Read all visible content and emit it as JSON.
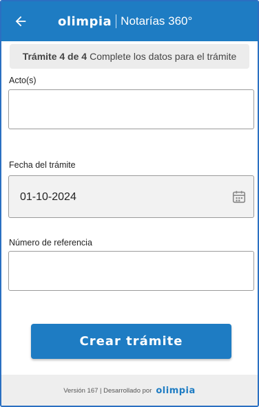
{
  "header": {
    "brand_logo": "OLIMPIA",
    "brand_subtitle": "Notarías 360°",
    "back_icon": "arrow-left-icon"
  },
  "step_banner": {
    "step_label": "Trámite 4 de 4",
    "instruction": "Complete los datos para el trámite"
  },
  "form": {
    "acto": {
      "label": "Acto(s)",
      "value": ""
    },
    "fecha": {
      "label": "Fecha del trámite",
      "value": "01-10-2024",
      "icon": "calendar-icon"
    },
    "referencia": {
      "label": "Número de referencia",
      "value": ""
    }
  },
  "actions": {
    "create_label": "Crear trámite"
  },
  "footer": {
    "version_text": "Versión 167 | Desarrollado por",
    "logo": "OLIMPIA"
  },
  "colors": {
    "primary": "#1e7cc3",
    "banner_bg": "#ececec",
    "footer_bg": "#eeeeee"
  }
}
